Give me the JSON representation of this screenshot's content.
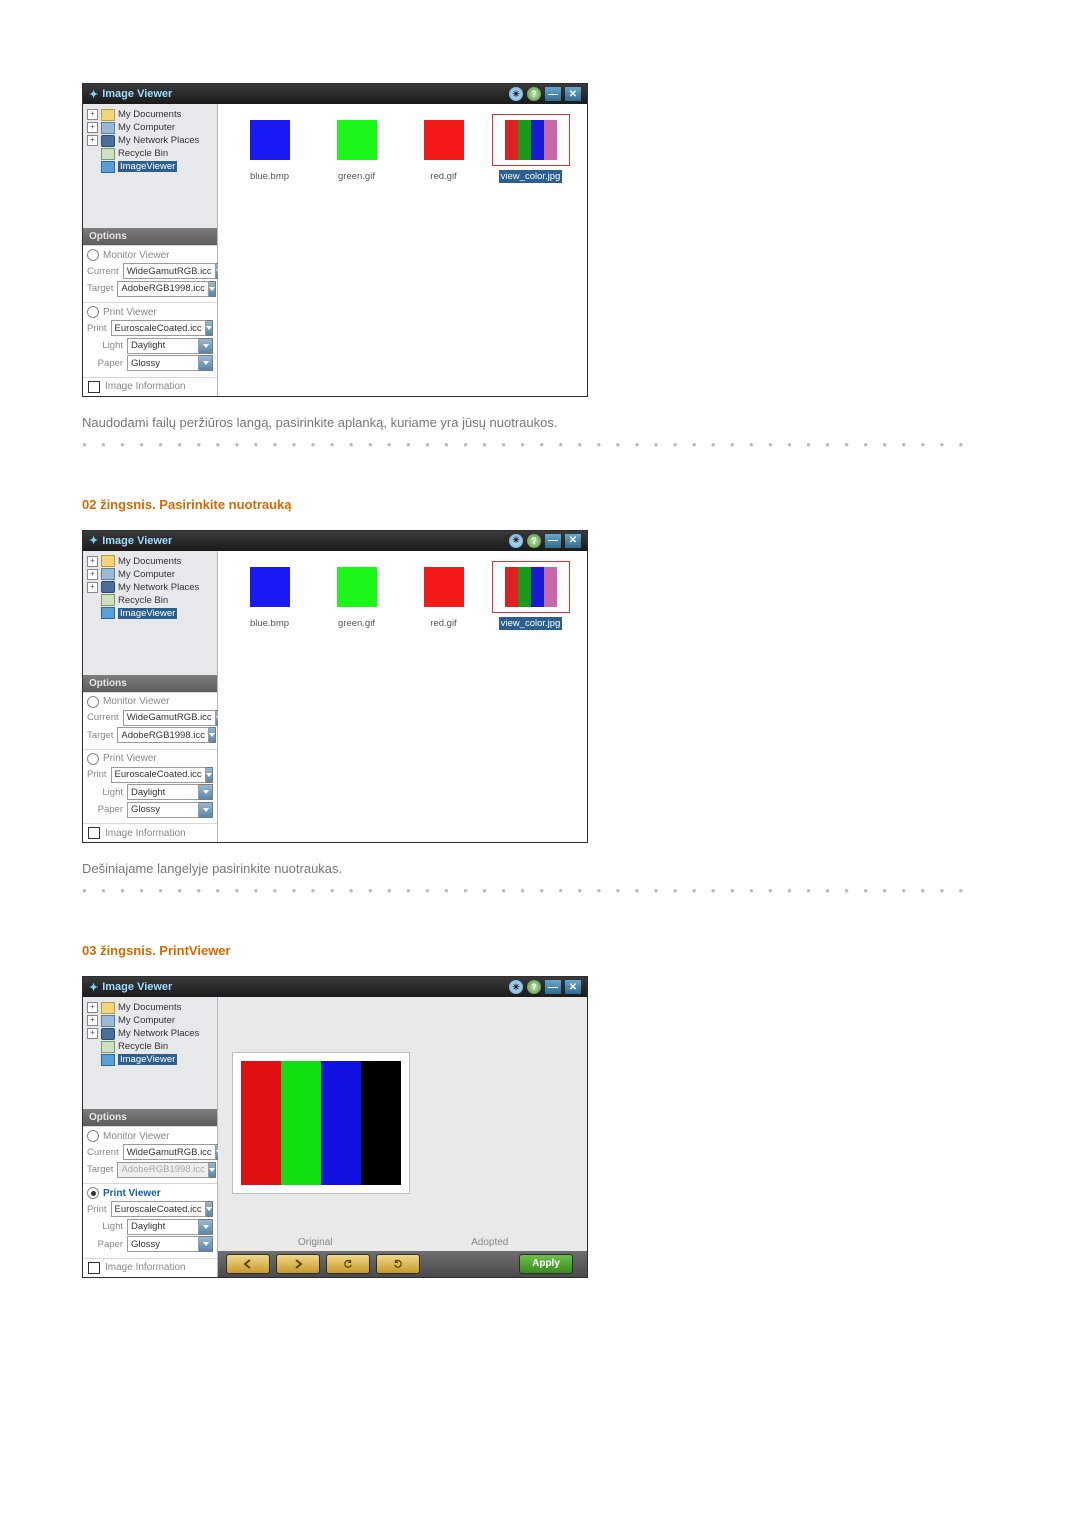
{
  "window": {
    "title": "Image Viewer",
    "icons": {
      "glow": "✦",
      "help": "?",
      "min": "—",
      "close": "✕"
    }
  },
  "tree": {
    "items": [
      {
        "label": "My Documents",
        "icon": "folder",
        "expand": true
      },
      {
        "label": "My Computer",
        "icon": "comp",
        "expand": true
      },
      {
        "label": "My Network Places",
        "icon": "net",
        "expand": true
      },
      {
        "label": "Recycle Bin",
        "icon": "bin",
        "expand": false
      },
      {
        "label": "ImageViewer",
        "icon": "sel",
        "expand": false
      }
    ]
  },
  "options": {
    "header": "Options",
    "monitor": {
      "title": "Monitor Viewer",
      "current": {
        "label": "Current",
        "value": "WideGamutRGB.icc"
      },
      "target": {
        "label": "Target",
        "value": "AdobeRGB1998.icc"
      }
    },
    "print": {
      "title": "Print Viewer",
      "print": {
        "label": "Print",
        "value": "EuroscaleCoated.icc"
      },
      "light": {
        "label": "Light",
        "value": "Daylight"
      },
      "paper": {
        "label": "Paper",
        "value": "Glossy"
      }
    },
    "info": "Image Information"
  },
  "thumbs": [
    {
      "name": "blue.bmp",
      "color": "#1a1af5"
    },
    {
      "name": "green.gif",
      "color": "#1af51a"
    },
    {
      "name": "red.gif",
      "color": "#f51a1a"
    }
  ],
  "thumb_sel": {
    "name": "view_color.jpg",
    "colors": [
      "#d22",
      "#1a9a1a",
      "#1a1ad2",
      "#c96aa8"
    ]
  },
  "step1_text": "Naudodami failų peržiūros langą, pasirinkite aplanką, kuriame yra jūsų nuotraukos.",
  "step2_h": "02 žingsnis. Pasirinkite nuotrauką",
  "step2_text": "Dešiniajame langelyje pasirinkite nuotraukas.",
  "step3_h": "03 žingsnis. PrintViewer",
  "pv": {
    "canvas_colors": [
      "#e01010",
      "#10e010",
      "#1010e0",
      "#000000"
    ],
    "label_original": "Original",
    "label_adopted": "Adopted",
    "apply": "Apply"
  },
  "dots": "● ● ● ● ● ● ● ● ● ● ● ● ● ● ● ● ● ● ● ● ● ● ● ● ● ● ● ● ● ● ● ● ● ● ● ● ● ● ● ● ● ● ● ● ● ● ●"
}
